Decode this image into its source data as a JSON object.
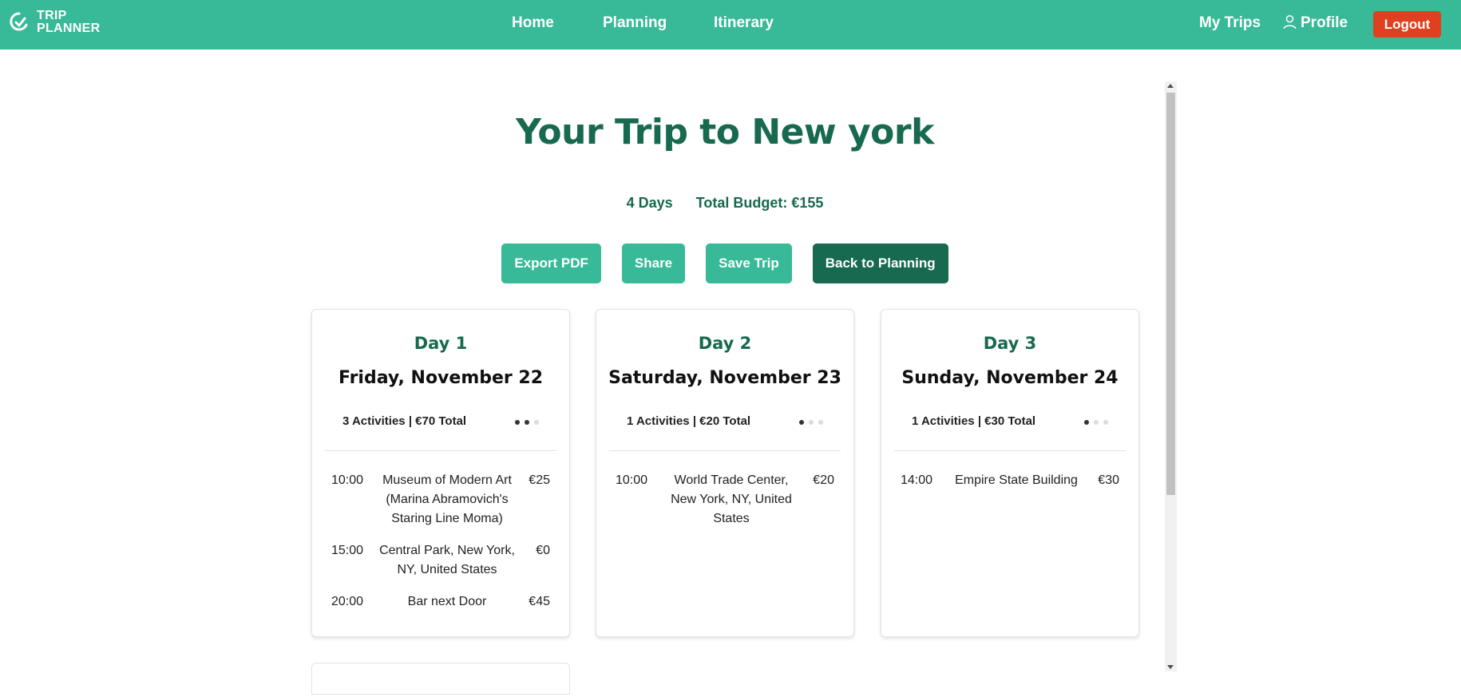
{
  "brand": {
    "line1": "TRIP",
    "line2": "PLANNER"
  },
  "nav": {
    "home": "Home",
    "planning": "Planning",
    "itinerary": "Itinerary",
    "my_trips": "My Trips",
    "profile": "Profile",
    "logout": "Logout"
  },
  "page": {
    "title": "Your Trip to New york",
    "days": "4 Days",
    "budget": "Total Budget: €155"
  },
  "actions": {
    "export_pdf": "Export PDF",
    "share": "Share",
    "save_trip": "Save Trip",
    "back": "Back to Planning"
  },
  "days": [
    {
      "label": "Day 1",
      "date": "Friday, November 22",
      "summary": "3 Activities | €70 Total",
      "activities": [
        {
          "time": "10:00",
          "name": "Museum of Modern Art (Marina Abramovich's Staring Line Moma)",
          "price": "€25"
        },
        {
          "time": "15:00",
          "name": "Central Park, New York, NY, United States",
          "price": "€0"
        },
        {
          "time": "20:00",
          "name": "Bar next Door",
          "price": "€45"
        }
      ]
    },
    {
      "label": "Day 2",
      "date": "Saturday, November 23",
      "summary": "1 Activities | €20 Total",
      "activities": [
        {
          "time": "10:00",
          "name": "World Trade Center, New York, NY, United States",
          "price": "€20"
        }
      ]
    },
    {
      "label": "Day 3",
      "date": "Sunday, November 24",
      "summary": "1 Activities | €30 Total",
      "activities": [
        {
          "time": "14:00",
          "name": "Empire State Building",
          "price": "€30"
        }
      ]
    }
  ],
  "colors": {
    "primary": "#38b997",
    "dark": "#17694f",
    "danger": "#e0401f"
  }
}
